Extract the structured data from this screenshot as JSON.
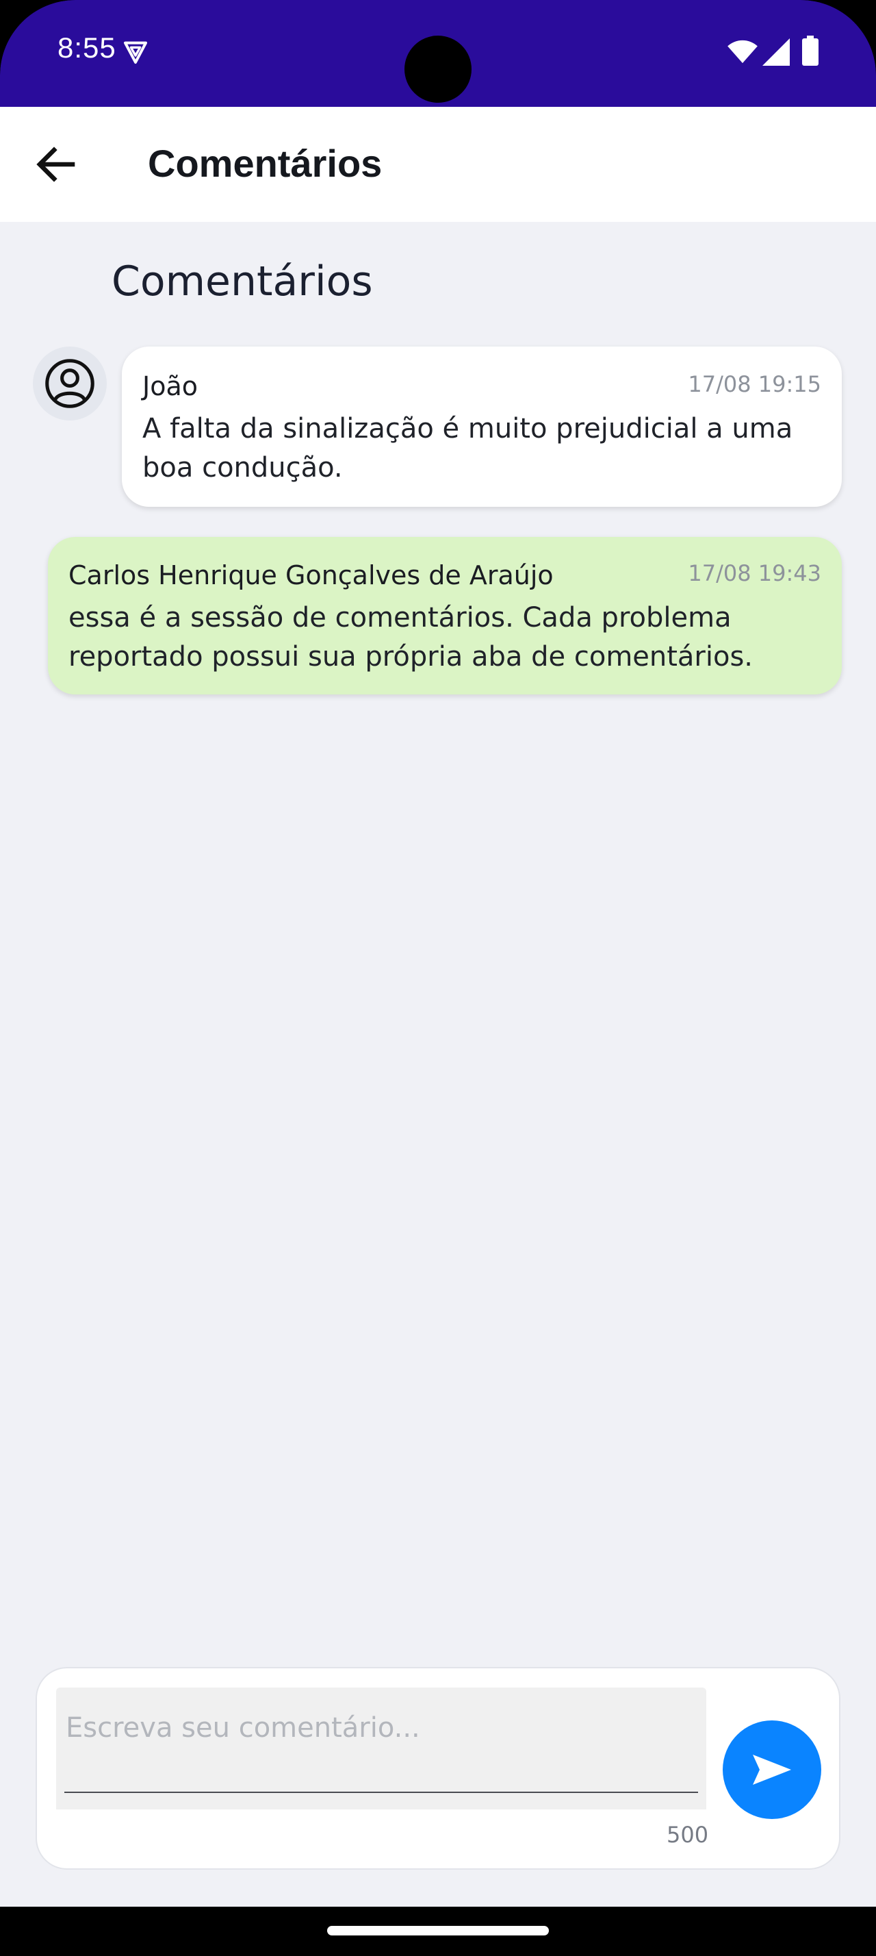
{
  "status_bar": {
    "time": "8:55",
    "icons": [
      "vpn-icon",
      "wifi-icon",
      "signal-icon",
      "battery-icon"
    ]
  },
  "app_bar": {
    "back_icon": "arrow-left-icon",
    "title": "Comentários"
  },
  "section": {
    "title": "Comentários"
  },
  "comments": [
    {
      "author": "João",
      "timestamp": "17/08 19:15",
      "text": "A falta da sinalização é muito prejudicial a uma boa condução.",
      "has_avatar": true,
      "bubble_color": "#ffffff"
    },
    {
      "author": "Carlos Henrique Gonçalves de Araújo",
      "timestamp": "17/08 19:43",
      "text": "essa é a sessão de comentários. Cada problema reportado possui sua própria aba de comentários.",
      "has_avatar": false,
      "bubble_color": "#dbf4c5"
    }
  ],
  "composer": {
    "placeholder": "Escreva seu comentário...",
    "value": "",
    "char_counter": "500",
    "send_icon": "send-icon"
  },
  "colors": {
    "status_bar": "#2a0c9b",
    "background": "#f0f1f6",
    "accent": "#0a84ff",
    "own_bubble": "#dbf4c5"
  }
}
